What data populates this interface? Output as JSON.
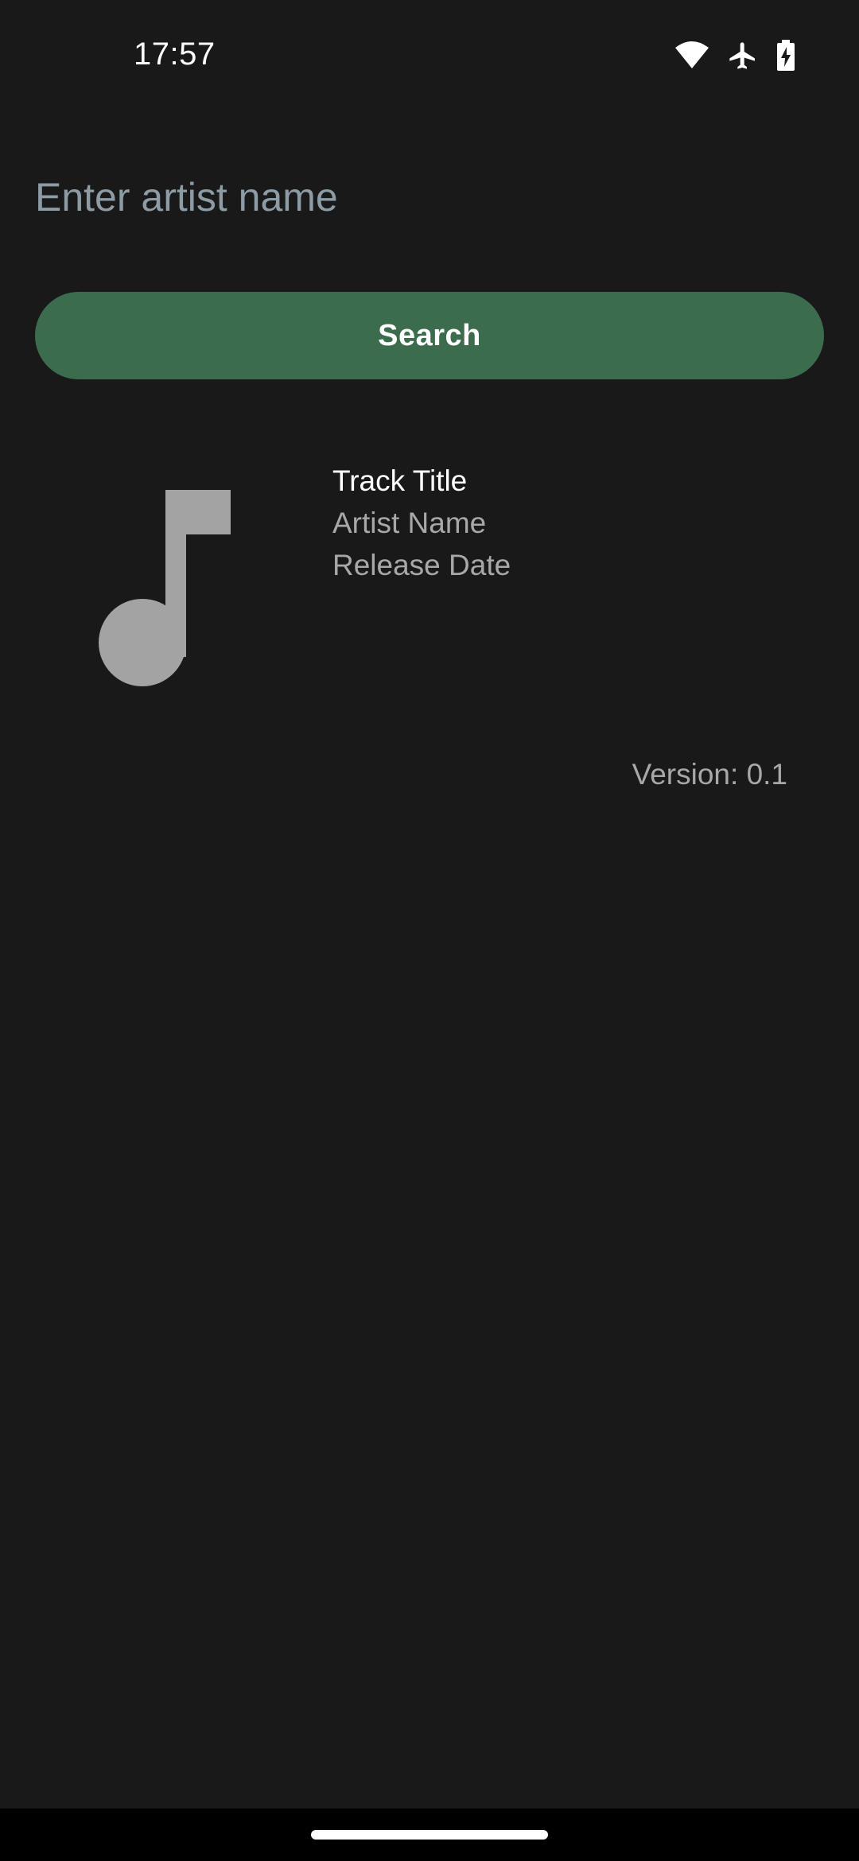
{
  "status_bar": {
    "time": "17:57",
    "icons": [
      "wifi-icon",
      "airplane-mode-icon",
      "battery-charging-icon"
    ]
  },
  "search": {
    "placeholder": "Enter artist name",
    "value": "",
    "button_label": "Search"
  },
  "results": [
    {
      "icon": "music-note-icon",
      "title": "Track Title",
      "artist": "Artist Name",
      "release_date": "Release Date"
    }
  ],
  "footer": {
    "version": "Version: 0.1"
  },
  "colors": {
    "background": "#191919",
    "accent_button": "#3c6c4e",
    "placeholder": "#8d9ba5",
    "secondary_text": "#a8a8a8",
    "icon_gray": "#a3a3a3"
  }
}
